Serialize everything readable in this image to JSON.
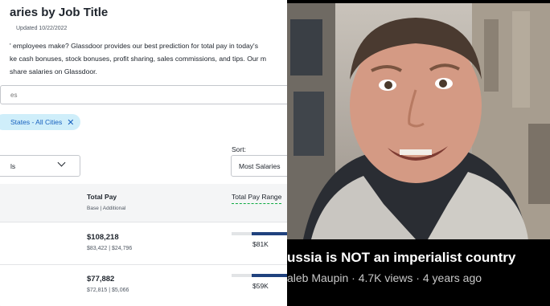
{
  "salaries": {
    "title": "aries by Job Title",
    "updated": "Updated 10/22/2022",
    "description": [
      "' employees make? Glassdoor provides our best prediction for total pay in today's",
      "ke cash bonuses, stock bonuses, profit sharing, sales commissions, and tips. Our m",
      " share salaries on Glassdoor."
    ],
    "search_placeholder": "es",
    "chip_label": "States - All Cities",
    "chip_close": "✕",
    "sort_label": "Sort:",
    "filter_value": "ls",
    "sort_value": "Most Salaries",
    "columns": {
      "total_pay": "Total Pay",
      "total_pay_sub": "Base | Additional",
      "range": "Total Pay Range"
    },
    "rows": [
      {
        "total": "$108,218",
        "breakdown": "$83,422 | $24,796",
        "median": "$81K"
      },
      {
        "total": "$77,882",
        "breakdown": "$72,815 | $5,066",
        "median": "$59K"
      }
    ]
  },
  "video": {
    "title": "ussia is NOT an imperialist country",
    "meta": "aleb Maupin · 4.7K views · 4 years ago"
  },
  "colors": {
    "chip_bg": "#cfeefa",
    "chip_text": "#1861bf",
    "bar_fill": "#20427e",
    "range_underline": "#0caa41",
    "video_bg": "#000000"
  }
}
